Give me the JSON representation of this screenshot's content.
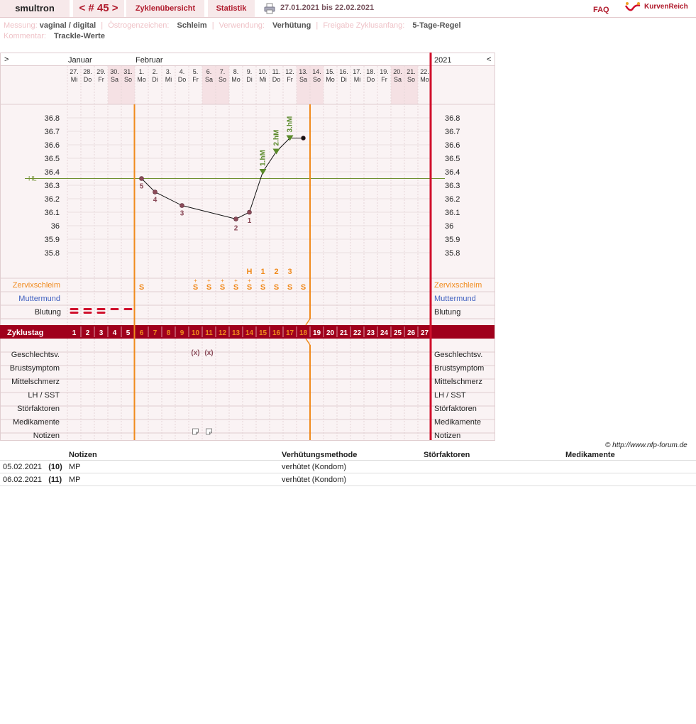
{
  "header": {
    "brand": "smultron",
    "cycle": "< # 45 >",
    "tabs": [
      "Zyklenübersicht",
      "Statistik"
    ],
    "date_range": "27.01.2021 bis 22.02.2021",
    "faq": "FAQ",
    "logo_text": "KurvenReich"
  },
  "meta": {
    "row1": [
      {
        "key": "Messung:",
        "value": "vaginal / digital"
      },
      {
        "key": "Östrogenzeichen:",
        "value": "Schleim"
      },
      {
        "key": "Verwendung:",
        "value": "Verhütung"
      },
      {
        "key": "Freigabe Zyklusanfang:",
        "value": "5-Tage-Regel"
      }
    ],
    "row2": [
      {
        "key": "Kommentar:",
        "value": "Trackle-Werte"
      }
    ]
  },
  "chart": {
    "nav_prev": ">",
    "nav_next": "<",
    "year": "2021",
    "months": [
      {
        "label": "Januar",
        "start_index": 0
      },
      {
        "label": "Februar",
        "start_index": 5
      }
    ],
    "days": [
      {
        "d": "27.",
        "w": "Mi"
      },
      {
        "d": "28.",
        "w": "Do"
      },
      {
        "d": "29.",
        "w": "Fr"
      },
      {
        "d": "30.",
        "w": "Sa",
        "we": true
      },
      {
        "d": "31.",
        "w": "So",
        "we": true
      },
      {
        "d": "1.",
        "w": "Mo"
      },
      {
        "d": "2.",
        "w": "Di"
      },
      {
        "d": "3.",
        "w": "Mi"
      },
      {
        "d": "4.",
        "w": "Do"
      },
      {
        "d": "5.",
        "w": "Fr"
      },
      {
        "d": "6.",
        "w": "Sa",
        "we": true
      },
      {
        "d": "7.",
        "w": "So",
        "we": true
      },
      {
        "d": "8.",
        "w": "Mo"
      },
      {
        "d": "9.",
        "w": "Di"
      },
      {
        "d": "10.",
        "w": "Mi"
      },
      {
        "d": "11.",
        "w": "Do"
      },
      {
        "d": "12.",
        "w": "Fr"
      },
      {
        "d": "13.",
        "w": "Sa",
        "we": true
      },
      {
        "d": "14.",
        "w": "So",
        "we": true
      },
      {
        "d": "15.",
        "w": "Mo"
      },
      {
        "d": "16.",
        "w": "Di"
      },
      {
        "d": "17.",
        "w": "Mi"
      },
      {
        "d": "18.",
        "w": "Do"
      },
      {
        "d": "19.",
        "w": "Fr"
      },
      {
        "d": "20.",
        "w": "Sa",
        "we": true
      },
      {
        "d": "21.",
        "w": "So",
        "we": true
      },
      {
        "d": "22.",
        "w": "Mo"
      }
    ],
    "temp_ticks": [
      "36.8",
      "36.7",
      "36.6",
      "36.5",
      "36.4",
      "36.3",
      "36.2",
      "36.1",
      "36",
      "35.9",
      "35.8"
    ],
    "hl_label": "HL",
    "row_labels": {
      "cervix": "Zervixschleim",
      "os": "Muttermund",
      "bleeding": "Blutung",
      "cycle_day": "Zyklustag",
      "lower": [
        "Geschlechtsv.",
        "Brustsymptom",
        "Mittelschmerz",
        "LH / SST",
        "Störfaktoren",
        "Medikamente",
        "Notizen"
      ]
    },
    "cycle_day_numbers": [
      "1",
      "2",
      "3",
      "4",
      "5",
      "6",
      "7",
      "8",
      "9",
      "10",
      "11",
      "12",
      "13",
      "14",
      "15",
      "16",
      "17",
      "18",
      "19",
      "20",
      "21",
      "22",
      "23",
      "24",
      "25",
      "26",
      "27"
    ],
    "mucus_above_labels": [
      {
        "day": 14,
        "label": "H"
      },
      {
        "day": 15,
        "label": "1"
      },
      {
        "day": 16,
        "label": "2"
      },
      {
        "day": 17,
        "label": "3"
      }
    ],
    "mucus_symbol": "S",
    "hm_labels": [
      "1.hM",
      "2.hM",
      "3.hM"
    ],
    "intercourse_symbol": "(x)",
    "colors": {
      "accent": "#b01a2c",
      "cycle_bar": "#a0001c",
      "orange": "#f08a1c",
      "green": "#5a8a2a",
      "hl_line": "#6f8f2f",
      "point": "#8a4a58",
      "weekend": "#f5e1e4",
      "bg": "#faf3f4",
      "blue": "#4060c0"
    }
  },
  "chart_data": {
    "type": "line",
    "x": [
      6,
      7,
      9,
      13,
      14,
      15,
      16,
      17,
      18
    ],
    "values": [
      36.35,
      36.25,
      36.15,
      36.05,
      36.1,
      36.4,
      36.55,
      36.65,
      36.65
    ],
    "point_labels": [
      "5",
      "4",
      "3",
      "2",
      "1",
      "1.hM",
      "2.hM",
      "3.hM",
      ""
    ],
    "hl": 36.35,
    "ylim": [
      35.75,
      36.85
    ],
    "xlim": [
      1,
      27
    ],
    "bleeding_days": [
      1,
      2,
      3,
      4,
      5
    ],
    "mucus_days": [
      6,
      10,
      11,
      12,
      13,
      14,
      15,
      16,
      17,
      18
    ],
    "intercourse_days": [
      10,
      11
    ],
    "note_days": [
      10,
      11
    ],
    "fertile_start_day": 6,
    "cycle_end_day": 18
  },
  "notes_table": {
    "headers": [
      "",
      "Notizen",
      "Verhütungsmethode",
      "Störfaktoren",
      "Medikamente"
    ],
    "rows": [
      {
        "date": "05.02.2021",
        "day": "(10)",
        "note": "MP",
        "method": "verhütet (Kondom)",
        "disturb": "",
        "meds": ""
      },
      {
        "date": "06.02.2021",
        "day": "(11)",
        "note": "MP",
        "method": "verhütet (Kondom)",
        "disturb": "",
        "meds": ""
      }
    ]
  },
  "footer": {
    "copyright": "© http://www.nfp-forum.de"
  }
}
